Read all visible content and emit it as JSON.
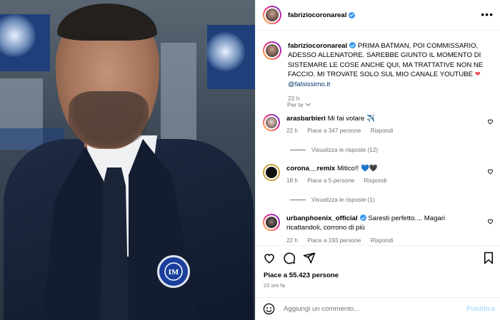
{
  "post": {
    "username": "fabriziocoronareal",
    "caption_text": "PRIMA BATMAN, POI COMMISSARIO, ADESSO ALLENATORE. SAREBBE GIUNTO IL MOMENTO DI SISTEMARE LE COSE ANCHE QUI, MA TRATTATIVE NON NE FACCIO. MI TROVATE SOLO SUL MIO CANALE YOUTUBE",
    "caption_mention": "@falsissimo.it",
    "caption_time": "22 h",
    "translate_label": "Per te"
  },
  "comments": [
    {
      "username": "arasbarbieri",
      "text": "Mi fai volare ✈️",
      "time": "22 h",
      "likes": "Piace a 347 persone",
      "reply_label": "Rispondi",
      "replies_label": "Visualizza le risposte (12)"
    },
    {
      "username": "corona__remix",
      "text": "Mitico!! 💙🖤",
      "time": "18 h",
      "likes": "Piace a 5 persone",
      "reply_label": "Rispondi",
      "replies_label": "Visualizza le risposte (1)"
    },
    {
      "username": "urbanphoenix_official",
      "text": "Saresti perfetto.... Magari ricattandoli, corrono di più",
      "time": "22 h",
      "likes": "Piace a 193 persone",
      "reply_label": "Rispondi"
    }
  ],
  "footer": {
    "likes": "Piace a 55.423 persone",
    "date": "22 ore fa",
    "comment_placeholder": "Aggiungi un commento...",
    "publish_label": "Pubblica"
  },
  "icons": {
    "like": "heart-icon",
    "comment": "comment-icon",
    "share": "share-icon",
    "save": "bookmark-icon",
    "emoji": "emoji-icon",
    "more": "more-icon"
  },
  "colors": {
    "verified": "#3897f0",
    "secondary_text": "#737373",
    "publish_disabled": "#b2dffc"
  }
}
